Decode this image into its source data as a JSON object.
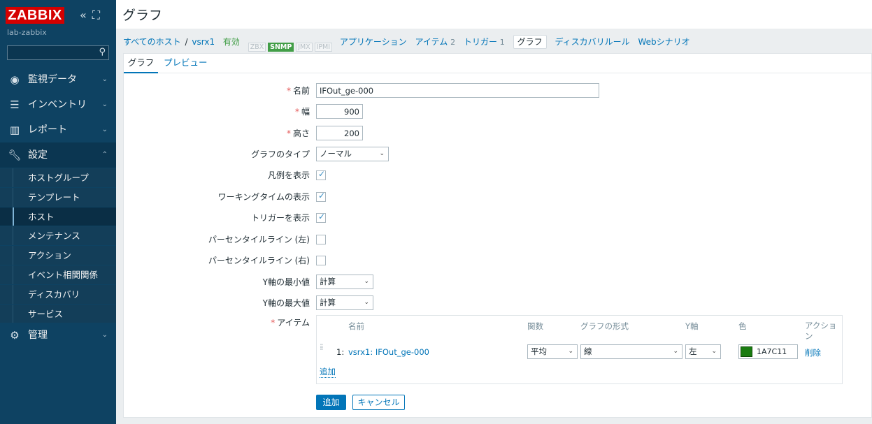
{
  "sidebar": {
    "logo": "ZABBIX",
    "server_name": "lab-zabbix",
    "search_placeholder": "",
    "menu": [
      {
        "label": "監視データ",
        "icon": "eye-icon"
      },
      {
        "label": "インベントリ",
        "icon": "list-icon"
      },
      {
        "label": "レポート",
        "icon": "bar-chart-icon"
      },
      {
        "label": "設定",
        "icon": "wrench-icon"
      },
      {
        "label": "管理",
        "icon": "gear-icon"
      }
    ],
    "submenu": [
      "ホストグループ",
      "テンプレート",
      "ホスト",
      "メンテナンス",
      "アクション",
      "イベント相関関係",
      "ディスカバリ",
      "サービス"
    ]
  },
  "header": {
    "title": "グラフ"
  },
  "host_nav": {
    "all_hosts": "すべてのホスト",
    "separator": "/",
    "host": "vsrx1",
    "status": "有効",
    "badges": [
      {
        "label": "ZBX",
        "on": false
      },
      {
        "label": "SNMP",
        "on": true
      },
      {
        "label": "JMX",
        "on": false
      },
      {
        "label": "IPMI",
        "on": false
      }
    ],
    "applications": "アプリケーション",
    "items": "アイテム",
    "items_count": "2",
    "triggers": "トリガー",
    "triggers_count": "1",
    "graphs": "グラフ",
    "discovery": "ディスカバリルール",
    "web": "Webシナリオ"
  },
  "tabs": {
    "graph": "グラフ",
    "preview": "プレビュー"
  },
  "form": {
    "name_label": "名前",
    "name_value": "IFOut_ge-000",
    "width_label": "幅",
    "width_value": "900",
    "height_label": "高さ",
    "height_value": "200",
    "graph_type_label": "グラフのタイプ",
    "graph_type_value": "ノーマル",
    "show_legend_label": "凡例を表示",
    "show_working_time_label": "ワーキングタイムの表示",
    "show_triggers_label": "トリガーを表示",
    "percentile_left_label": "パーセンタイルライン (左)",
    "percentile_right_label": "パーセンタイルライン (右)",
    "ymin_label": "Y軸の最小値",
    "ymin_value": "計算",
    "ymax_label": "Y軸の最大値",
    "ymax_value": "計算",
    "items_label": "アイテム"
  },
  "items_table": {
    "headers": {
      "name": "名前",
      "function": "関数",
      "draw_style": "グラフの形式",
      "y_axis": "Y軸",
      "color": "色",
      "action": "アクション"
    },
    "rows": [
      {
        "num": "1:",
        "name": "vsrx1: IFOut_ge-000",
        "function": "平均",
        "draw_style": "線",
        "y_axis": "左",
        "color": "1A7C11",
        "action": "削除"
      }
    ],
    "add": "追加"
  },
  "buttons": {
    "add": "追加",
    "cancel": "キャンセル"
  },
  "colors": {
    "accent": "#0275b8",
    "sidebar": "#0e4262",
    "logo": "#d40000",
    "ok": "#429e47",
    "item_color": "#1a7c11"
  }
}
